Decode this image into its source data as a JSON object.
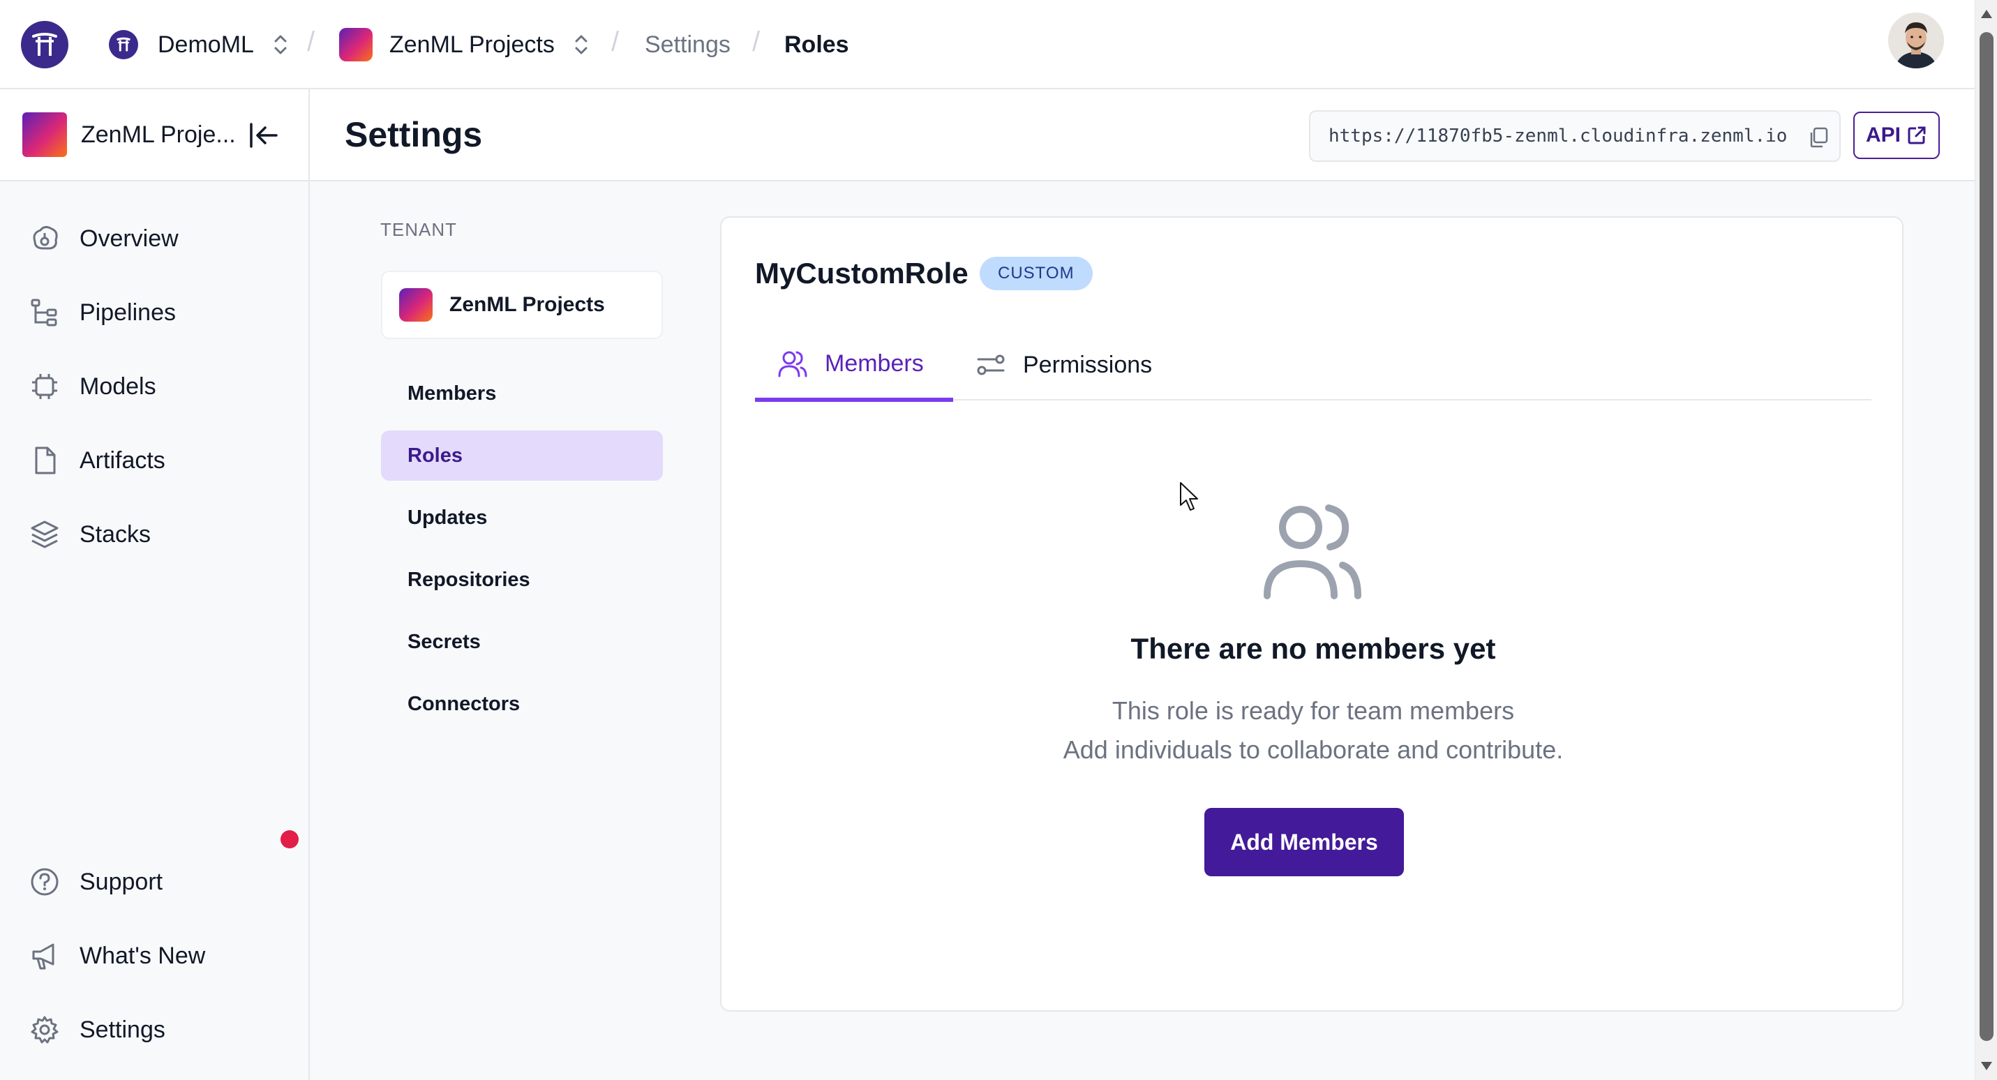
{
  "topbar": {
    "org_name": "DemoML",
    "project_name": "ZenML Projects",
    "separator": "/",
    "crumb_settings": "Settings",
    "crumb_current": "Roles"
  },
  "sidebar": {
    "project_name": "ZenML Proje...",
    "items": [
      {
        "label": "Overview",
        "icon": "overview-icon"
      },
      {
        "label": "Pipelines",
        "icon": "pipelines-icon"
      },
      {
        "label": "Models",
        "icon": "models-icon"
      },
      {
        "label": "Artifacts",
        "icon": "artifacts-icon"
      },
      {
        "label": "Stacks",
        "icon": "stacks-icon"
      }
    ],
    "bottom_items": [
      {
        "label": "Support",
        "icon": "support-icon"
      },
      {
        "label": "What's New",
        "icon": "megaphone-icon"
      },
      {
        "label": "Settings",
        "icon": "gear-icon"
      }
    ]
  },
  "header": {
    "title": "Settings",
    "url": "https://11870fb5-zenml.cloudinfra.zenml.io",
    "api_label": "API"
  },
  "settings_nav": {
    "section_label": "TENANT",
    "tenant_name": "ZenML Projects",
    "items": [
      "Members",
      "Roles",
      "Updates",
      "Repositories",
      "Secrets",
      "Connectors"
    ],
    "active": "Roles"
  },
  "role": {
    "name": "MyCustomRole",
    "badge": "CUSTOM",
    "tabs": [
      "Members",
      "Permissions"
    ],
    "active_tab": "Members",
    "empty_title": "There are no members yet",
    "empty_line_1": "This role is ready for team members",
    "empty_line_2": "Add individuals to collaborate and contribute.",
    "add_button": "Add Members"
  },
  "colors": {
    "brand": "#431a99",
    "accent": "#7c3aed",
    "active_nav_bg": "#e4dafc",
    "badge_bg": "#bfdbfe",
    "notification_dot": "#e11d48"
  }
}
